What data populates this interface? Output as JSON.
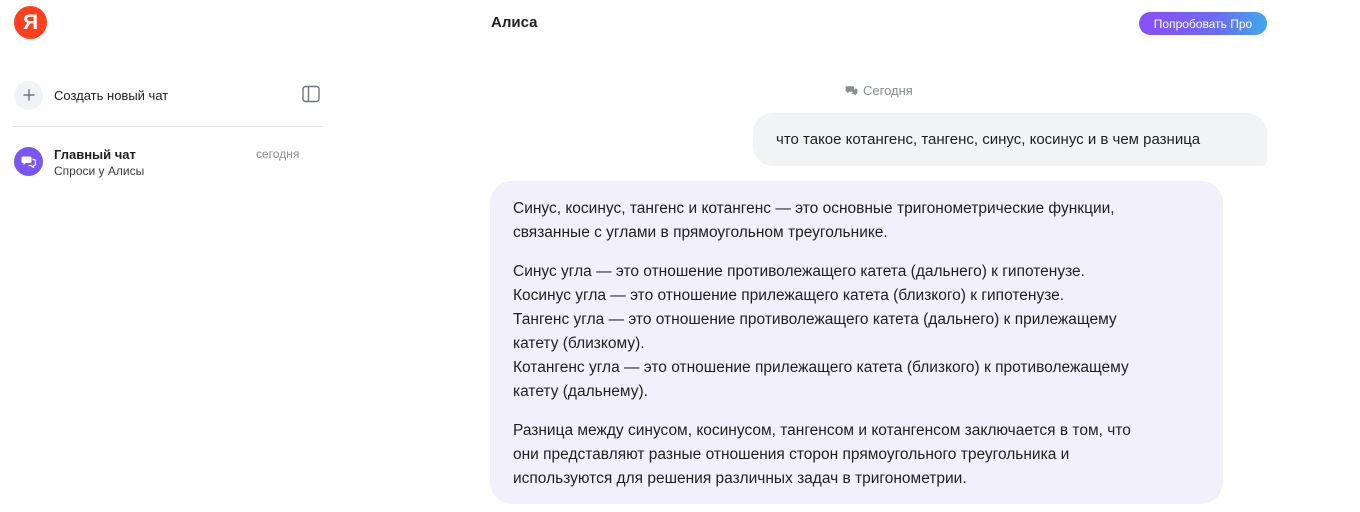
{
  "app": {
    "logo_letter": "Я",
    "title": "Алиса",
    "pro_button_label": "Попробовать Про"
  },
  "sidebar": {
    "new_chat_label": "Создать новый чат",
    "chats": [
      {
        "title": "Главный чат",
        "subtitle": "Спроси у Алисы",
        "date": "сегодня"
      }
    ]
  },
  "conversation": {
    "date_separator": "Сегодня",
    "user_message": "что такое котангенс, тангенс, синус, косинус и в чем разница",
    "assistant_message": {
      "paragraph1": {
        "line1": "Синус, косинус, тангенс и котангенс — это основные тригонометрические функции,",
        "line2": "связанные с углами в прямоугольном треугольнике."
      },
      "paragraph2": {
        "line1": "Синус угла — это отношение противолежащего катета (дальнего) к гипотенузе.",
        "line2": "Косинус угла — это отношение прилежащего катета (близкого) к гипотенузе.",
        "line3": "Тангенс угла — это отношение противолежащего катета (дальнего) к прилежащему",
        "line4": "катету (близкому).",
        "line5": "Котангенс угла — это отношение прилежащего катета (близкого) к противолежащему",
        "line6": "катету (дальнему)."
      },
      "paragraph3": {
        "line1": "Разница между синусом, косинусом, тангенсом и котангенсом заключается в том, что",
        "line2": "они представляют разные отношения сторон прямоугольного треугольника и",
        "line3": "используются для решения различных задач в тригонометрии."
      }
    }
  },
  "colors": {
    "logo_red": "#fc3f1d",
    "avatar_purple": "#7a57f0",
    "assistant_bubble_bg": "#f2f0fd",
    "user_bubble_bg": "#f2f3f5"
  },
  "icons": {
    "plus": "plus-icon",
    "panel_toggle": "sidebar-panel-icon",
    "chat_avatar": "chat-bubbles-icon",
    "date_separator": "chat-bubbles-icon"
  }
}
